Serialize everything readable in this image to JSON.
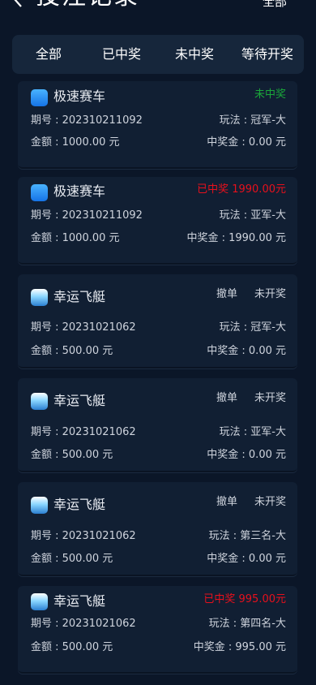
{
  "header": {
    "title": "投注记录",
    "filter_label": "全部"
  },
  "tabs": [
    {
      "label": "全部"
    },
    {
      "label": "已中奖"
    },
    {
      "label": "未中奖"
    },
    {
      "label": "等待开奖"
    }
  ],
  "bets": [
    {
      "game": "极速赛车",
      "logo_icon": "speed-racing-logo",
      "status": "未中奖",
      "status_color": "#1aa83a",
      "period": "期号 : 202310211092",
      "play": "玩法 : 冠军-大",
      "amount": "金额 : 1000.00 元",
      "prize": "中奖金 : 0.00 元"
    },
    {
      "game": "极速赛车",
      "logo_icon": "speed-racing-logo",
      "status": "已中奖 1990.00元",
      "status_color": "#e8101c",
      "period": "期号 : 202310211092",
      "play": "玩法 : 亚军-大",
      "amount": "金额 : 1000.00 元",
      "prize": "中奖金 : 1990.00 元"
    },
    {
      "game": "幸运飞艇",
      "logo_icon": "lucky-airship-logo",
      "cancel": "撤单",
      "status": "未开奖",
      "period": "期号 : 20231021062",
      "play": "玩法 : 冠军-大",
      "amount": "金额 : 500.00 元",
      "prize": "中奖金 : 0.00 元"
    },
    {
      "game": "幸运飞艇",
      "logo_icon": "lucky-airship-logo",
      "cancel": "撤单",
      "status": "未开奖",
      "period": "期号 : 20231021062",
      "play": "玩法 : 亚军-大",
      "amount": "金额 : 500.00 元",
      "prize": "中奖金 : 0.00 元"
    },
    {
      "game": "幸运飞艇",
      "logo_icon": "lucky-airship-logo",
      "cancel": "撤单",
      "status": "未开奖",
      "period": "期号 : 20231021062",
      "play": "玩法 : 第三名-大",
      "amount": "金额 : 500.00 元",
      "prize": "中奖金 : 0.00 元"
    },
    {
      "game": "幸运飞艇",
      "logo_icon": "lucky-airship-logo",
      "status": "已中奖 995.00元",
      "status_color": "#e8101c",
      "period": "期号 : 20231021062",
      "play": "玩法 : 第四名-大",
      "amount": "金额 : 500.00 元",
      "prize": "中奖金 : 995.00 元"
    }
  ]
}
